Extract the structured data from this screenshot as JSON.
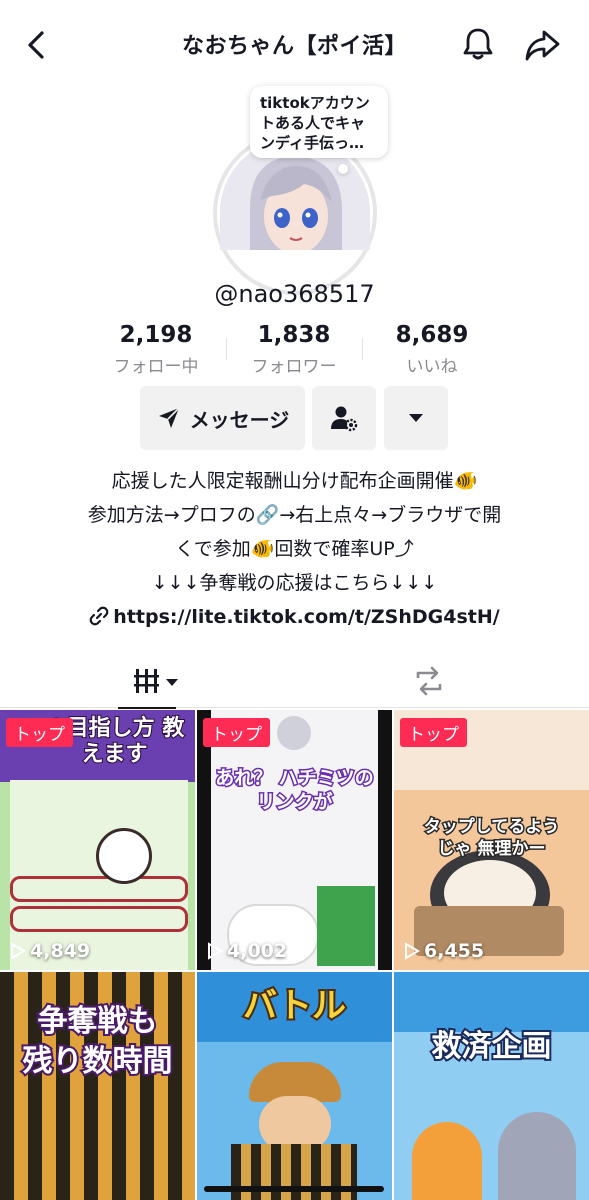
{
  "header": {
    "title": "なおちゃん【ポイ活】",
    "back_icon": "chevron-left-icon",
    "bell_icon": "bell-icon",
    "share_icon": "share-arrow-icon"
  },
  "profile": {
    "note_bubble": "tiktokアカウントある人でキャンディ手伝っ…",
    "username": "@nao368517"
  },
  "stats": [
    {
      "value": "2,198",
      "label": "フォロー中"
    },
    {
      "value": "1,838",
      "label": "フォロワー"
    },
    {
      "value": "8,689",
      "label": "いいね"
    }
  ],
  "actions": {
    "message_label": "メッセージ",
    "user_settings_icon": "user-gear-icon",
    "more_icon": "caret-down-icon"
  },
  "bio": {
    "lines": [
      "応援した人限定報酬山分け配布企画開催🐠",
      "参加方法→プロフの🔗→右上点々→ブラウザで開",
      "くで参加🐠回数で確率UP⤴",
      "↓↓↓争奪戦の応援はこちら↓↓↓"
    ],
    "link": "https://lite.tiktok.com/t/ZShDG4stH/"
  },
  "tabs": {
    "videos_icon": "grid-bars-icon",
    "repost_icon": "repost-icon"
  },
  "videos": [
    {
      "badge": "トップ",
      "views": "4,849",
      "caption": "の目指し方 教えます",
      "color": "#b9e3a7"
    },
    {
      "badge": "トップ",
      "views": "4,002",
      "caption": "あれ？ ハチミツのリンクが",
      "color": "#f4f4f6"
    },
    {
      "badge": "トップ",
      "views": "6,455",
      "caption": "タップしてるようじゃ 無理かー",
      "color": "#f3c79a"
    },
    {
      "badge": "",
      "views": "",
      "caption": "争奪戦も 残り数時間",
      "color": "#2a2418"
    },
    {
      "badge": "",
      "views": "",
      "caption": "バトル",
      "color": "#2f8fd8"
    },
    {
      "badge": "",
      "views": "",
      "caption": "救済企画",
      "color": "#3d9be0"
    }
  ],
  "colors": {
    "badge": "#fe2c55",
    "text": "#161823",
    "muted": "#8a8b91",
    "button_bg": "#f1f1f2"
  }
}
